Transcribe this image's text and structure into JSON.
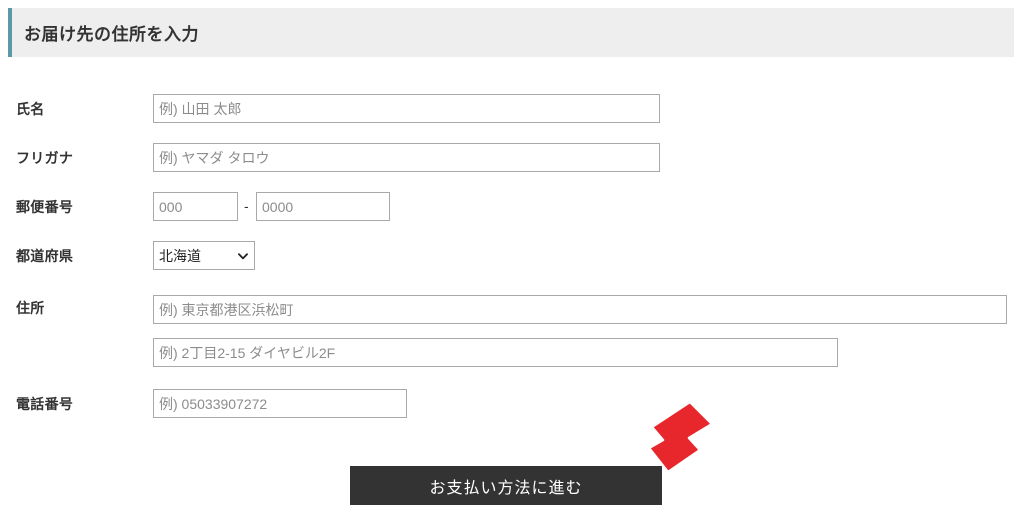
{
  "section": {
    "title": "お届け先の住所を入力",
    "accent_color": "#5a9aa8",
    "background_color": "#eeeeee"
  },
  "form": {
    "fields": [
      {
        "label": "氏名",
        "placeholder": "例) 山田 太郎"
      },
      {
        "label": "フリガナ",
        "placeholder": "例) ヤマダ タロウ"
      },
      {
        "label": "郵便番号",
        "placeholder_1": "000",
        "separator": "-",
        "placeholder_2": "0000"
      },
      {
        "label": "都道府県",
        "selected": "北海道",
        "chevron": "chevron-down-icon"
      },
      {
        "label": "住所",
        "placeholder_1": "例) 東京都港区浜松町",
        "placeholder_2": "例) 2丁目2-15 ダイヤビル2F"
      },
      {
        "label": "電話番号",
        "placeholder": "例) 05033907272"
      }
    ]
  },
  "submit": {
    "label": "お支払い方法に進む",
    "background_color": "#333333",
    "text_color": "#ffffff"
  },
  "annotation": {
    "arrow": "arrow-down-left-icon",
    "color": "#e8272c"
  }
}
